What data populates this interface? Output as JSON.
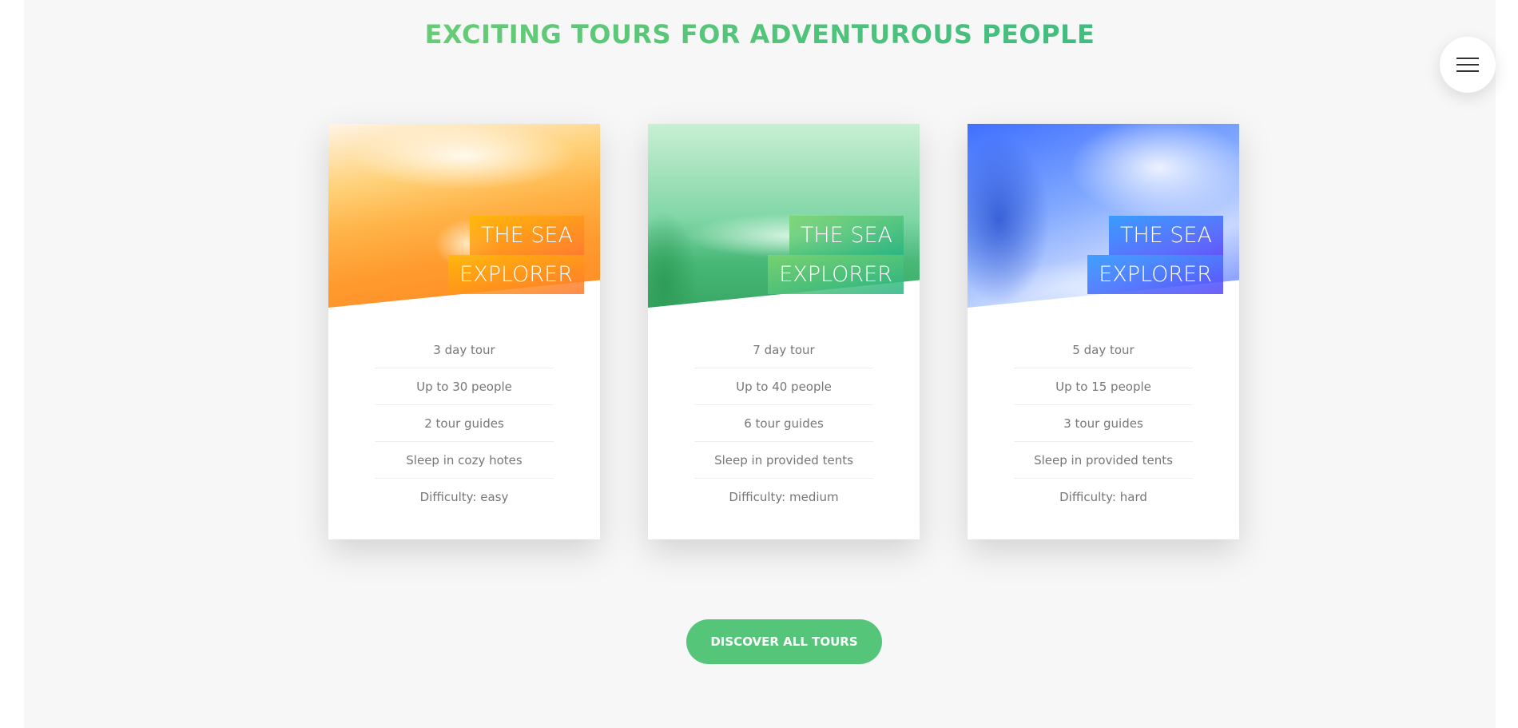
{
  "section": {
    "heading": "Exciting tours for adventurous people"
  },
  "menu": {
    "icon": "hamburger-menu-icon"
  },
  "cards": [
    {
      "title_line1": "The Sea",
      "title_line2": "Explorer",
      "theme_color": "#ff9a2e",
      "details": [
        "3 day tour",
        "Up to 30 people",
        "2 tour guides",
        "Sleep in cozy hotes",
        "Difficulty: easy"
      ]
    },
    {
      "title_line1": "The Sea",
      "title_line2": "Explorer",
      "theme_color": "#55c57a",
      "details": [
        "7 day tour",
        "Up to 40 people",
        "6 tour guides",
        "Sleep in provided tents",
        "Difficulty: medium"
      ]
    },
    {
      "title_line1": "The Sea",
      "title_line2": "Explorer",
      "theme_color": "#5643fa",
      "details": [
        "5 day tour",
        "Up to 15 people",
        "3 tour guides",
        "Sleep in provided tents",
        "Difficulty: hard"
      ]
    }
  ],
  "cta": {
    "label": "Discover all tours",
    "color": "#55c57a"
  },
  "colors": {
    "heading_gradient_start": "#7ed56f",
    "heading_gradient_end": "#28b485",
    "background": "#f7f7f7"
  }
}
